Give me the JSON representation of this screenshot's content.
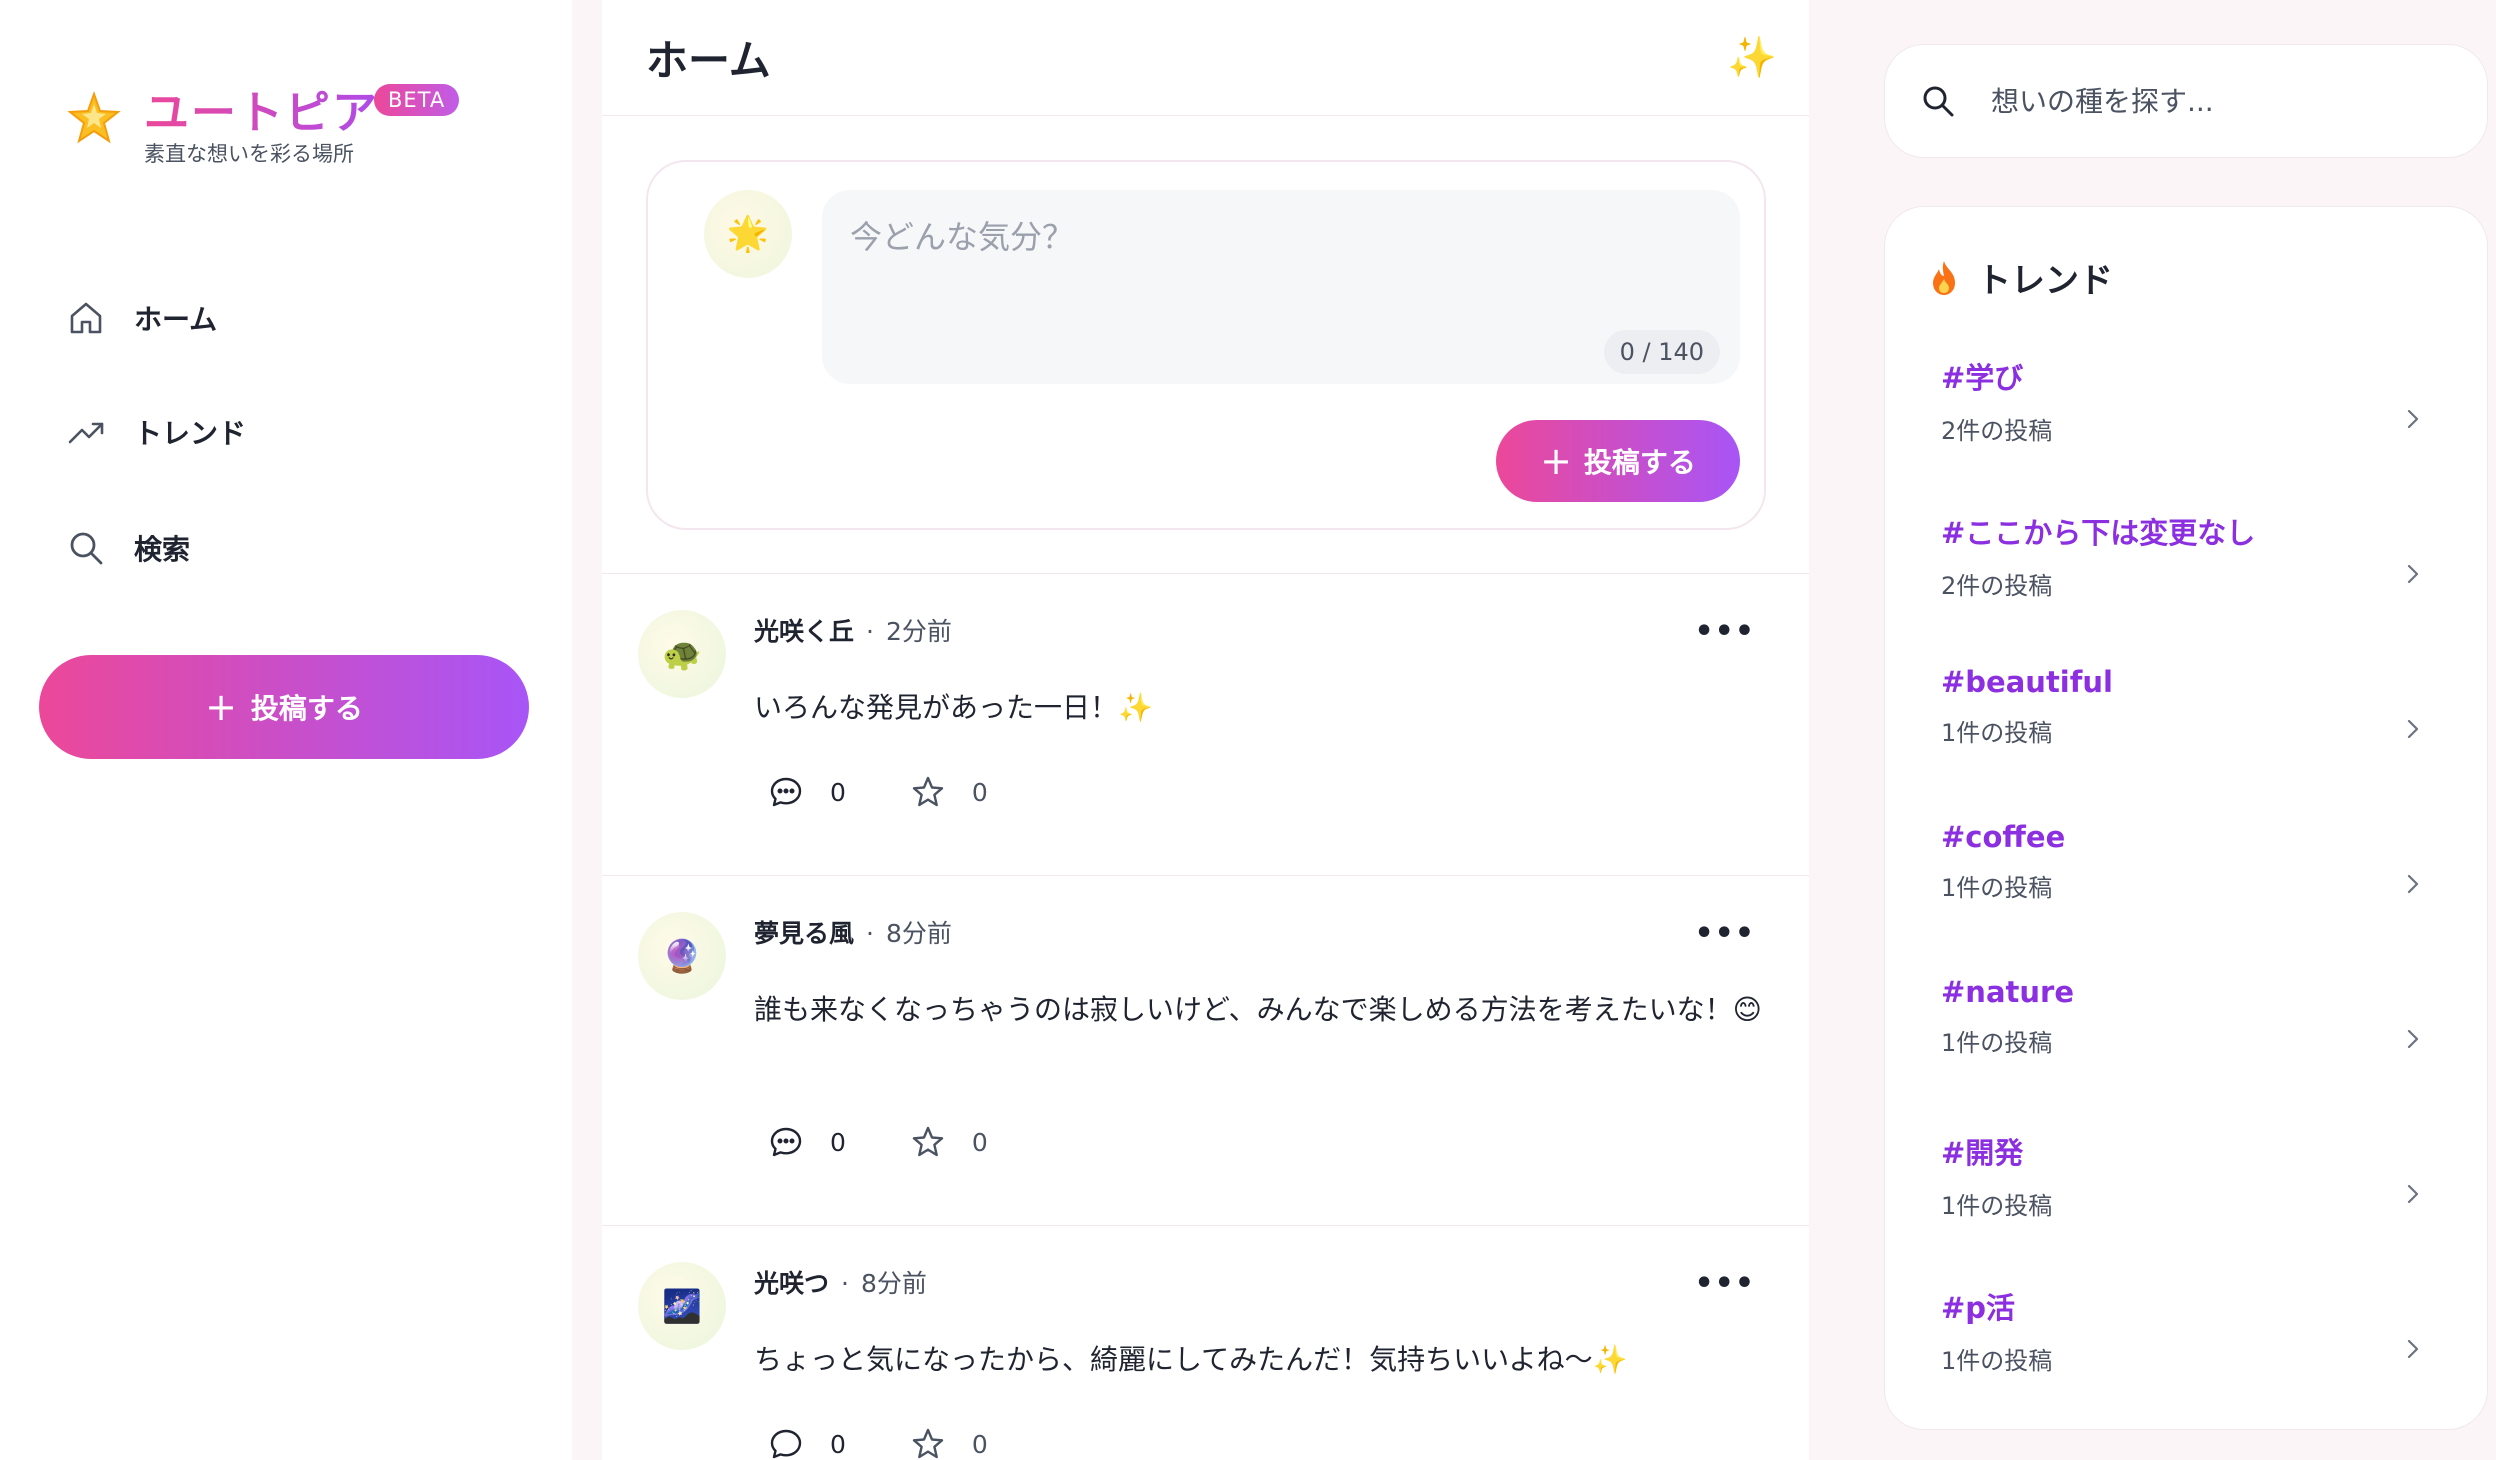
{
  "brand": {
    "name": "ユートピア",
    "badge": "BETA",
    "tagline": "素直な想いを彩る場所",
    "logo_icon": "star-icon"
  },
  "nav": {
    "items": [
      {
        "label": "ホーム",
        "icon": "home-icon"
      },
      {
        "label": "トレンド",
        "icon": "trending-icon"
      },
      {
        "label": "検索",
        "icon": "search-icon"
      }
    ],
    "post_button": "投稿する"
  },
  "feed": {
    "title": "ホーム",
    "header_icon": "sparkles-icon",
    "composer": {
      "placeholder": "今どんな気分？",
      "char_count": "0 / 140",
      "submit_label": "投稿する",
      "avatar": "🌟"
    },
    "posts": [
      {
        "avatar": "🐢",
        "author": "光咲く丘",
        "time": "2分前",
        "text": "いろんな発見があった一日！✨",
        "comments": "0",
        "favorites": "0"
      },
      {
        "avatar": "🔮",
        "author": "夢見る風",
        "time": "8分前",
        "text": "誰も来なくなっちゃうのは寂しいけど、みんなで楽しめる方法を考えたいな！😊",
        "comments": "0",
        "favorites": "0"
      },
      {
        "avatar": "🌌",
        "author": "光咲つ",
        "time": "8分前",
        "text": "ちょっと気になったから、綺麗にしてみたんだ！気持ちいいよね〜✨",
        "comments": "0",
        "favorites": "0"
      }
    ]
  },
  "search": {
    "placeholder": "想いの種を探す..."
  },
  "trends": {
    "title": "トレンド",
    "title_icon": "fire-icon",
    "items": [
      {
        "tag": "#学び",
        "count": "2件の投稿"
      },
      {
        "tag": "#ここから下は変更なし",
        "count": "2件の投稿"
      },
      {
        "tag": "#beautiful",
        "count": "1件の投稿"
      },
      {
        "tag": "#coffee",
        "count": "1件の投稿"
      },
      {
        "tag": "#nature",
        "count": "1件の投稿"
      },
      {
        "tag": "#開発",
        "count": "1件の投稿"
      },
      {
        "tag": "#p活",
        "count": "1件の投稿"
      }
    ]
  },
  "colors": {
    "accent_start": "#ec4899",
    "accent_end": "#a855f7",
    "trend_tag": "#8b2fe0"
  }
}
